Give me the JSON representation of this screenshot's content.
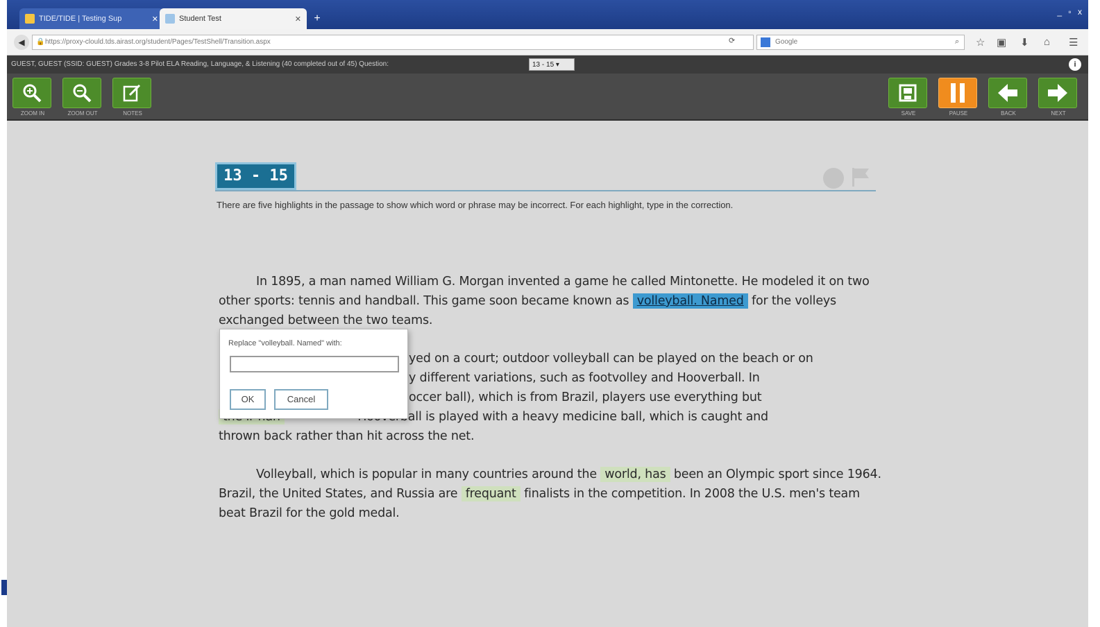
{
  "browser": {
    "tabs": [
      {
        "label": "TIDE/TIDE | Testing Sup"
      },
      {
        "label": "Student Test"
      }
    ],
    "new_tab": "+",
    "window_controls": "_ ▫ x",
    "url": "https://proxy-clould.tds.airast.org/student/Pages/TestShell/Transition.aspx",
    "search_placeholder": "Google"
  },
  "test_info": {
    "text": "GUEST, GUEST (SSID: GUEST) Grades 3-8 Pilot ELA Reading, Language, & Listening (40 completed out of 45)   Question:",
    "question_select": "13 - 15 ▾",
    "info_icon": "i"
  },
  "toolbar": {
    "left": [
      {
        "label": "ZOOM IN",
        "icon": "zoom-in-icon"
      },
      {
        "label": "ZOOM OUT",
        "icon": "zoom-out-icon"
      },
      {
        "label": "NOTES",
        "icon": "notes-icon"
      }
    ],
    "right": [
      {
        "label": "SAVE",
        "icon": "save-icon"
      },
      {
        "label": "PAUSE",
        "icon": "pause-icon"
      },
      {
        "label": "BACK",
        "icon": "arrow-left-icon"
      },
      {
        "label": "NEXT",
        "icon": "arrow-right-icon"
      }
    ]
  },
  "question": {
    "number": "13 - 15",
    "instructions": "There are five highlights in the passage to show which word or phrase may be incorrect. For each highlight, type in the correction."
  },
  "passage": {
    "p1": {
      "pre": "In 1895, a man named William G. Morgan invented a game he called Mintonette. He modeled it on two other sports: tennis and handball. This game soon became known as",
      "hl": "volleyball. Named",
      "post": "for the volleys exchanged between the two teams."
    },
    "p2": {
      "l1_pre": "",
      "l1_visible": "yed on a court; outdoor volleyball can be played on the beach or on",
      "l2_visible": "y different variations, such as footvolley and Hooverball. In",
      "l3_visible": "occer ball), which is from Brazil, players use everything but",
      "l4_hl": "the ir han",
      "l4_visible": "Hooverball is played with a heavy medicine ball, which is caught and",
      "l5": "thrown back rather than hit across the net."
    },
    "p3": {
      "pre": "Volleyball, which is popular in many countries around the",
      "hl1": "world, has",
      "mid": "been an Olympic sport since 1964. Brazil, the United States, and Russia are",
      "hl2": "frequant",
      "post": "finalists in the competition. In 2008 the U.S. men's team beat Brazil for the gold medal."
    }
  },
  "dialog": {
    "label": "Replace \"volleyball. Named\" with:",
    "input_value": "",
    "ok": "OK",
    "cancel": "Cancel"
  }
}
